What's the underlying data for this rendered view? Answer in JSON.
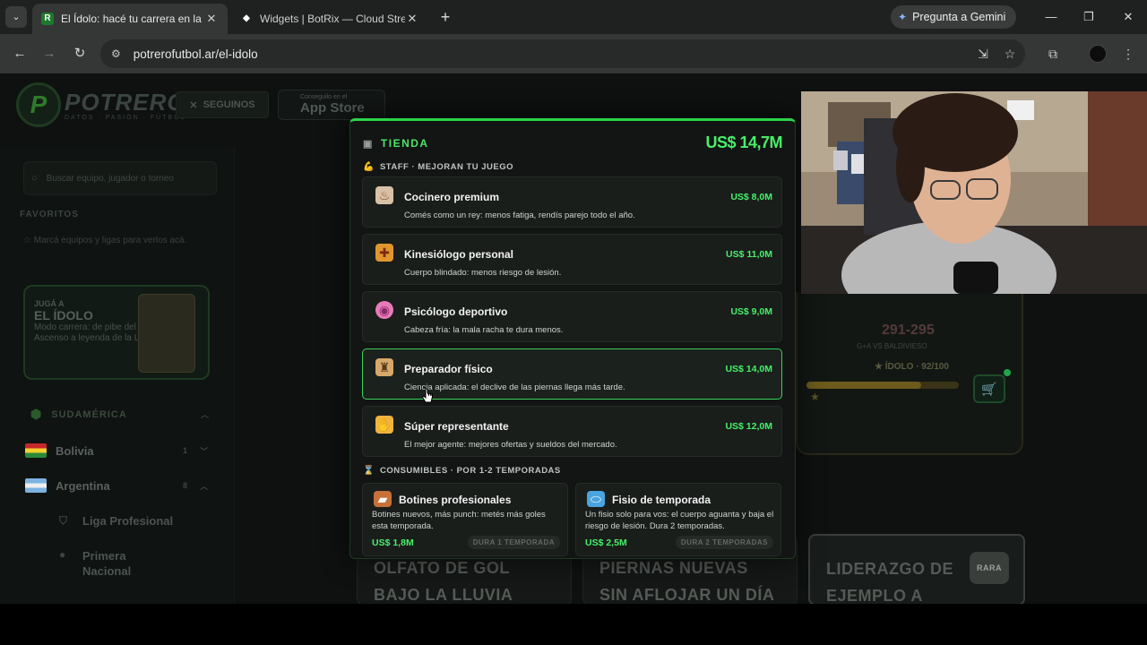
{
  "browser": {
    "tabs": [
      {
        "title": "El Ídolo: hacé tu carrera en la Li",
        "favicon": "R",
        "active": true
      },
      {
        "title": "Widgets | BotRix — Cloud Strea",
        "favicon": "◆",
        "active": false
      }
    ],
    "gemini_label": "Pregunta a Gemini",
    "url": "potrerofutbol.ar/el-idolo"
  },
  "site": {
    "logo_title": "POTRERO",
    "logo_subtitle": "DATOS · PASIÓN · FÚTBOL",
    "seguinos_label": "SEGUINOS",
    "appstore_small": "Conseguilo en el",
    "appstore_big": "App Store"
  },
  "sidebar": {
    "search_placeholder": "Buscar equipo, jugador o torneo",
    "favorites_label": "FAVORITOS",
    "favorites_hint": "Marcá equipos y ligas para verlos acá.",
    "promo": {
      "kicker": "JUGÁ A",
      "title": "EL ÍDOLO",
      "text": "Modo carrera: de pibe del Ascenso a leyenda de la Liga"
    },
    "region_label": "SUDAMÉRICA",
    "countries": [
      {
        "name": "Bolivia",
        "count": "1"
      },
      {
        "name": "Argentina",
        "count": "8"
      }
    ],
    "leagues": [
      "Liga Profesional",
      "Primera Nacional"
    ]
  },
  "background_panel": {
    "score": "291-295",
    "note": "G+A VS BALDIVIESO",
    "idolo": "ÍDOLO · 92/100",
    "idolo_progress": 0.75
  },
  "background_cards": [
    {
      "text": "OLFATO DE GOL BAJO LA LLUVIA"
    },
    {
      "text": "PIERNAS NUEVAS SIN AFLOJAR UN DÍA"
    },
    {
      "text": "LIDERAZGO DE EJEMPLO A PURA",
      "badge": "RARA"
    }
  ],
  "store": {
    "title": "TIENDA",
    "balance": "US$ 14,7M",
    "staff_label": "STAFF · MEJORAN TU JUEGO",
    "staff": [
      {
        "icon": "chef-icon",
        "name": "Cocinero premium",
        "desc": "Comés como un rey: menos fatiga, rendís parejo todo el año.",
        "price": "US$ 8,0M"
      },
      {
        "icon": "physio-icon",
        "name": "Kinesiólogo personal",
        "desc": "Cuerpo blindado: menos riesgo de lesión.",
        "price": "US$ 11,0M"
      },
      {
        "icon": "brain-icon",
        "name": "Psicólogo deportivo",
        "desc": "Cabeza fría: la mala racha te dura menos.",
        "price": "US$ 9,0M"
      },
      {
        "icon": "weightlifter-icon",
        "name": "Preparador físico",
        "desc": "Ciencia aplicada: el declive de las piernas llega más tarde.",
        "price": "US$ 14,0M"
      },
      {
        "icon": "handshake-icon",
        "name": "Súper representante",
        "desc": "El mejor agente: mejores ofertas y sueldos del mercado.",
        "price": "US$ 12,0M"
      }
    ],
    "consumables_label": "CONSUMIBLES · POR 1-2 TEMPORADAS",
    "consumables": [
      {
        "icon": "boot-icon",
        "name": "Botines profesionales",
        "desc": "Botines nuevos, más punch: metés más goles esta temporada.",
        "price": "US$ 1,8M",
        "duration": "DURA 1 TEMPORADA"
      },
      {
        "icon": "pill-icon",
        "name": "Fisio de temporada",
        "desc": "Un fisio solo para vos: el cuerpo aguanta y baja el riesgo de lesión. Dura 2 temporadas.",
        "price": "US$ 2,5M",
        "duration": "DURA 2 TEMPORADAS"
      }
    ]
  },
  "colors": {
    "accent": "#47f06a",
    "brand_green": "#2bd44a"
  }
}
